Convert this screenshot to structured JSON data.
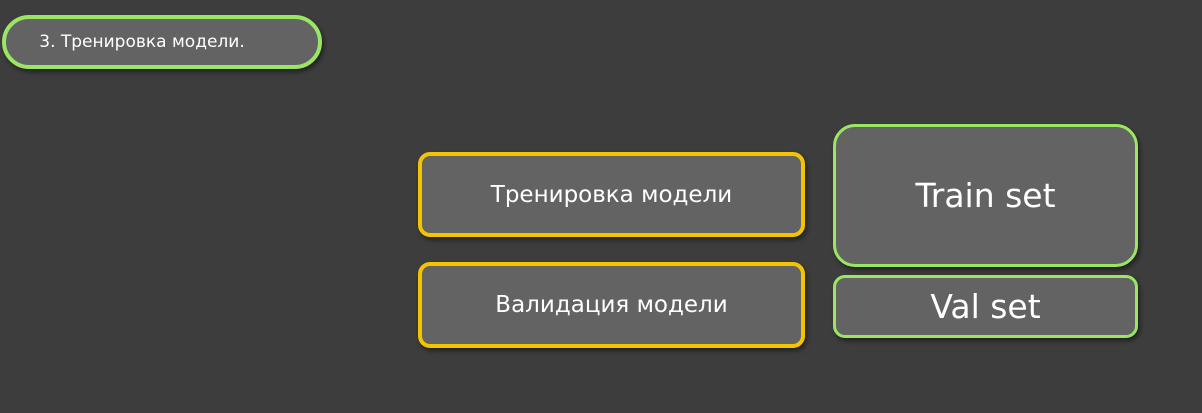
{
  "step_title": "3. Тренировка модели.",
  "actions": {
    "train_model": "Тренировка модели",
    "validate_model": "Валидация модели"
  },
  "datasets": {
    "train_set": "Train set",
    "val_set": "Val set"
  },
  "colors": {
    "background": "#3d3d3d",
    "box_fill": "#636363",
    "green_border": "#9be564",
    "yellow_border": "#f5c400",
    "text": "#ffffff"
  }
}
